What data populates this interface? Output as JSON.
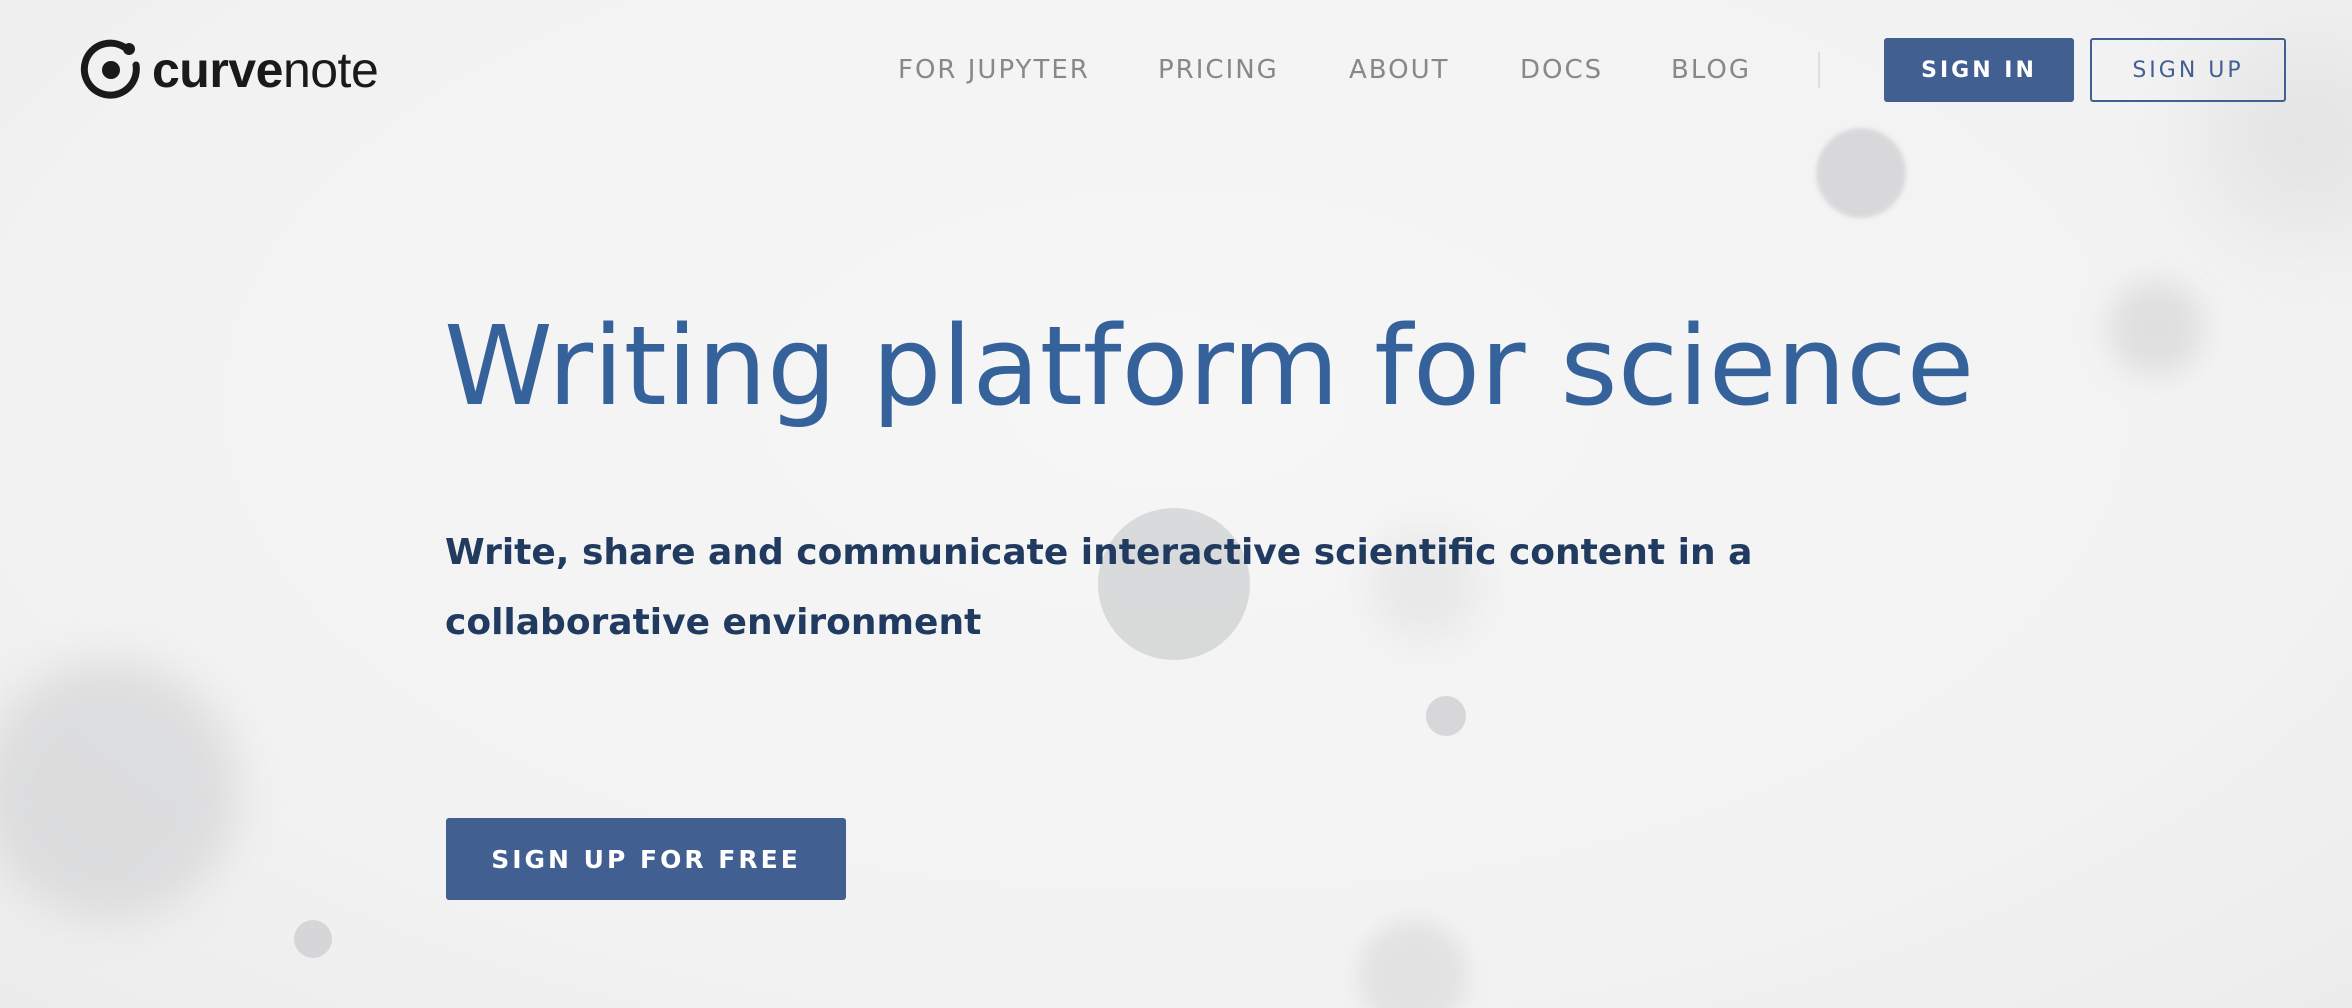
{
  "header": {
    "logo": {
      "icon": "curvenote-logo-icon",
      "text_bold": "curve",
      "text_light": "note"
    },
    "nav": [
      {
        "label": "FOR JUPYTER"
      },
      {
        "label": "PRICING"
      },
      {
        "label": "ABOUT"
      },
      {
        "label": "DOCS"
      },
      {
        "label": "BLOG"
      }
    ],
    "sign_in_label": "SIGN IN",
    "sign_up_label": "SIGN UP"
  },
  "hero": {
    "title": "Writing platform for science",
    "subtitle": "Write, share and communicate interactive scientific content in a collaborative environment",
    "cta_label": "SIGN UP FOR FREE"
  },
  "colors": {
    "primary": "#425f92",
    "title": "#36629b",
    "subtitle": "#213a5f",
    "nav": "#888888",
    "background": "#f4f4f4"
  }
}
